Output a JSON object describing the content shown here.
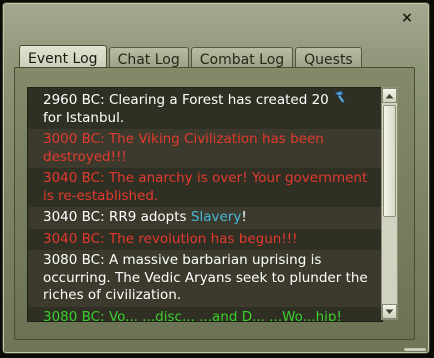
{
  "window": {
    "close_label": "×"
  },
  "tabs": [
    {
      "label": "Event Log",
      "active": true
    },
    {
      "label": "Chat Log",
      "active": false
    },
    {
      "label": "Combat Log",
      "active": false
    },
    {
      "label": "Quests",
      "active": false
    }
  ],
  "log": {
    "entries": [
      {
        "text": "2960 BC: Clearing a Forest has created 20",
        "suffix": "for Istanbul.",
        "icon": "hammer-icon",
        "color": "white"
      },
      {
        "text": "3000 BC: The Viking Civilization has been destroyed!!!",
        "color": "red"
      },
      {
        "text": "3040 BC: The anarchy is over! Your government is re-established.",
        "color": "red"
      },
      {
        "prefix": "3040 BC: RR9  adopts ",
        "link": "Slavery",
        "suffix": "!",
        "color": "white"
      },
      {
        "text": "3040 BC: The revolution has begun!!!",
        "color": "red"
      },
      {
        "text": "3080 BC: A massive barbarian uprising is occurring. The Vedic Aryans seek to plunder the riches of civilization.",
        "color": "white"
      },
      {
        "text": "3080 BC: Vo...  ...disc...  ...and D...  ...Wo...hip!",
        "color": "green"
      }
    ]
  },
  "colors": {
    "red_text": "#e23a2e",
    "white_text": "#ffffff",
    "link_text": "#48b8d8",
    "green_text": "#3ad02b"
  }
}
